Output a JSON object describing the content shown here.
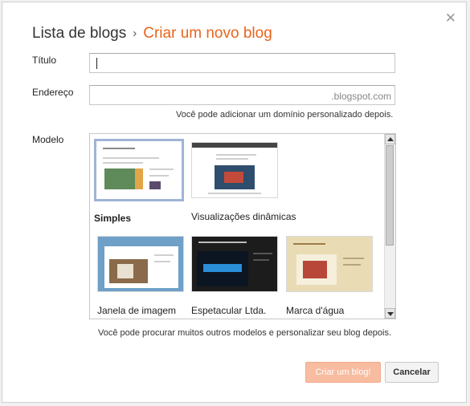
{
  "header": {
    "breadcrumb": "Lista de blogs",
    "separator": "›",
    "current": "Criar um novo blog",
    "close": "✕"
  },
  "form": {
    "title_label": "Título",
    "title_value": "",
    "address_label": "Endereço",
    "address_value": "",
    "address_suffix": ".blogspot.com",
    "domain_hint": "Você pode adicionar um domínio personalizado depois.",
    "template_label": "Modelo",
    "templates_hint": "Você pode procurar muitos outros modelos e personalizar seu blog depois."
  },
  "templates": [
    {
      "name": "Simples",
      "selected": true
    },
    {
      "name": "Visualizações dinâmicas",
      "selected": false
    },
    {
      "name": "Janela de imagem",
      "selected": false
    },
    {
      "name": "Espetacular Ltda.",
      "selected": false
    },
    {
      "name": "Marca d'água",
      "selected": false
    }
  ],
  "buttons": {
    "create": "Criar um blog!",
    "cancel": "Cancelar"
  },
  "colors": {
    "accent": "#e8641b",
    "create_button": "#f8bca0"
  }
}
